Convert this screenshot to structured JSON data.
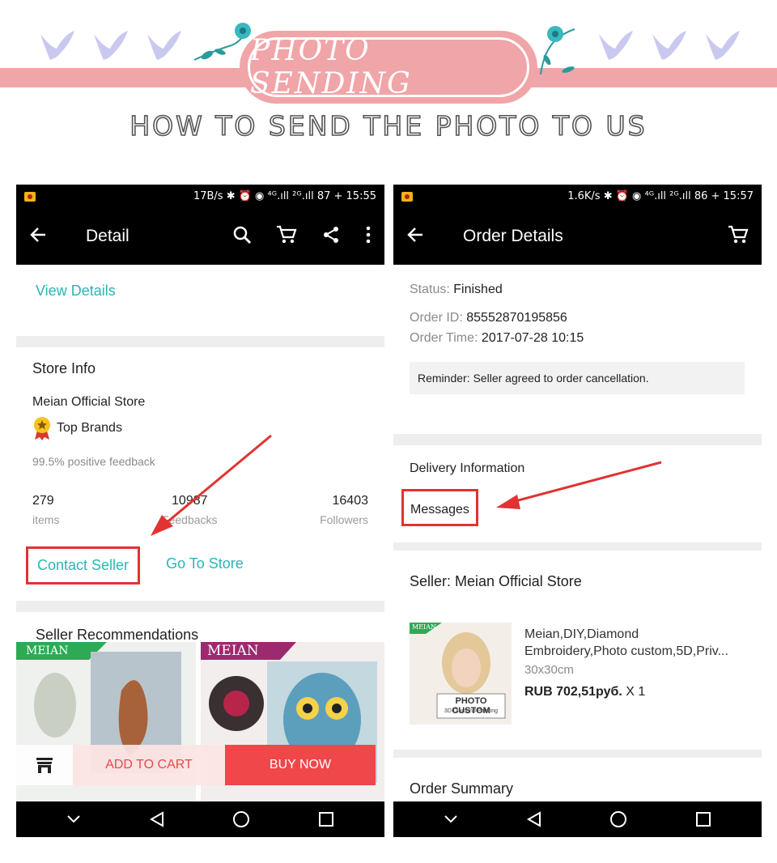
{
  "banner": {
    "title": "PHOTO SENDING",
    "subtitle": "HOW TO SEND THE PHOTO TO US"
  },
  "left_phone": {
    "status": {
      "text": "17B/s ✱ ⏰ ◉ ⁴ᴳ.ıll ²ᴳ.ıll 87 + 15:55"
    },
    "toolbar": {
      "title": "Detail"
    },
    "view_details": "View Details",
    "store_info": {
      "title": "Store Info",
      "store_name": "Meian Official Store",
      "badge_label": "Top Brands",
      "feedback": "99.5% positive feedback",
      "stats": [
        {
          "value": "279",
          "label": "items"
        },
        {
          "value": "10987",
          "label": "Feedbacks"
        },
        {
          "value": "16403",
          "label": "Followers"
        }
      ],
      "contact_seller": "Contact Seller",
      "go_to_store": "Go To Store"
    },
    "recommendations": {
      "title": "Seller Recommendations",
      "brand_1": "MEIAN",
      "brand_2": "MEIAN"
    },
    "bottom_bar": {
      "add_to_cart": "ADD TO CART",
      "buy_now": "BUY NOW"
    }
  },
  "right_phone": {
    "status": {
      "text": "1.6K/s ✱ ⏰ ◉ ⁴ᴳ.ıll ²ᴳ.ıll 86 + 15:57"
    },
    "toolbar": {
      "title": "Order Details"
    },
    "order": {
      "status_label": "Status:",
      "status_value": "Finished",
      "id_label": "Order ID:",
      "id_value": "85552870195856",
      "time_label": "Order Time:",
      "time_value": "2017-07-28 10:15",
      "reminder": "Reminder: Seller agreed to order cancellation."
    },
    "delivery": {
      "title": "Delivery Information",
      "messages": "Messages"
    },
    "seller": {
      "title": "Seller: Meian Official Store",
      "product_name": "Meian,DIY,Diamond Embroidery,Photo custom,5D,Priv...",
      "product_size": "30x30cm",
      "price": "RUB 702,51руб.",
      "qty": "X 1",
      "img_badge": "MEIAN",
      "img_caption": "PHOTO CUSTOM",
      "img_subcaption": "3D Diamond Painting"
    },
    "summary": {
      "title": "Order Summary"
    }
  },
  "colors": {
    "accent_teal": "#2bb5b5",
    "highlight_red": "#e23232",
    "banner_pink": "#f0a5a8",
    "buy_red": "#f0474a"
  }
}
